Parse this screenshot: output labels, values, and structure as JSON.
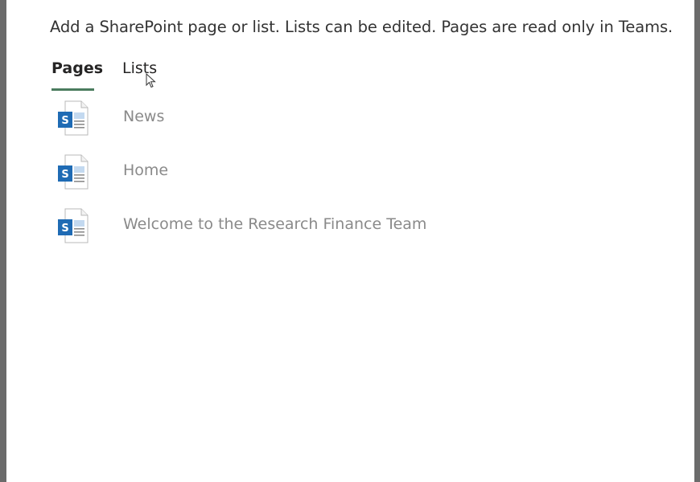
{
  "dialog": {
    "description": "Add a SharePoint page or list. Lists can be edited. Pages are read only in Teams.",
    "tabs": [
      {
        "label": "Pages",
        "selected": true
      },
      {
        "label": "Lists",
        "selected": false
      }
    ],
    "accent_color": "#4b7c5e",
    "pages": [
      {
        "label": "News",
        "icon": "sharepoint-page-icon"
      },
      {
        "label": "Home",
        "icon": "sharepoint-page-icon"
      },
      {
        "label": "Welcome to the Research Finance Team",
        "icon": "sharepoint-page-icon"
      }
    ]
  }
}
